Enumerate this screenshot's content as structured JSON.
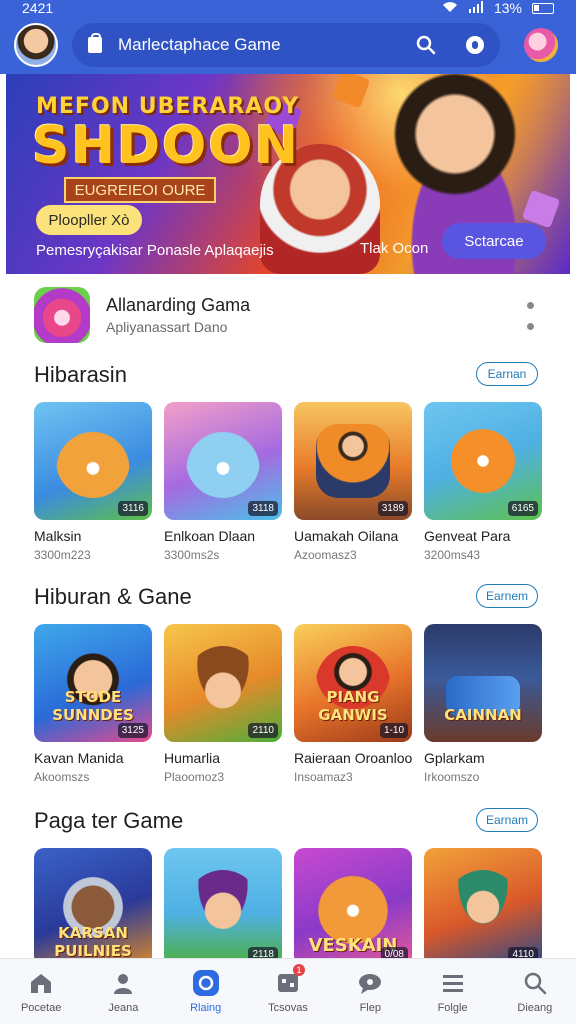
{
  "status_bar": {
    "time": "2421",
    "battery": "13%"
  },
  "search": {
    "placeholder": "Marlectaphace  Game"
  },
  "banner": {
    "title_line1": "MEFON UBERARAOY",
    "title_line2": "SHDOON",
    "ribbon": "EUGREIEOI OURE",
    "pill": "Ploopller Xò",
    "subtitle": "Pemesryçakisar Ponasle Aplaqaejis",
    "small_label": "Tlak Ocon",
    "cta": "Sctarcae"
  },
  "featured": {
    "name": "Allanarding Gama",
    "subtitle": "Apliyanassart Dano"
  },
  "sections": [
    {
      "title": "Hibarasin",
      "button": "Earnan",
      "items": [
        {
          "name": "Malksin",
          "sub": "3300m223",
          "badge": "3116"
        },
        {
          "name": "Enlkoan Dlaan",
          "sub": "3300ms2s",
          "badge": "3118"
        },
        {
          "name": "Uamakah Oilana",
          "sub": "Azoomasz3",
          "badge": "3189"
        },
        {
          "name": "Genveat Para",
          "sub": "3200ms43",
          "badge": "6165"
        }
      ]
    },
    {
      "title": "Hiburan & Gane",
      "button": "Earnem",
      "items": [
        {
          "name": "Kavan Manida",
          "sub": "Akoomszs",
          "badge": "3125",
          "art": "STODE SUNNDES"
        },
        {
          "name": "Humarlia",
          "sub": "Plaoomoz3",
          "badge": "2110",
          "art": ""
        },
        {
          "name": "Raieraan Oroanloo",
          "sub": "Insoamaz3",
          "badge": "1-10",
          "art": "PIANG GANWIS"
        },
        {
          "name": "Gplarkam",
          "sub": "Irkoomszo",
          "badge": "",
          "art": "CAINNAN"
        }
      ]
    },
    {
      "title": "Paga ter Game",
      "button": "Earnam",
      "items": [
        {
          "name": "",
          "sub": "",
          "badge": "",
          "art": "KARSAN PUILNIES"
        },
        {
          "name": "",
          "sub": "",
          "badge": "2118",
          "art": ""
        },
        {
          "name": "",
          "sub": "",
          "badge": "0/08",
          "art": "VESKAIN"
        },
        {
          "name": "",
          "sub": "",
          "badge": "4110",
          "art": ""
        }
      ]
    }
  ],
  "bottom_nav": [
    {
      "label": "Pocetae",
      "icon": "home-icon"
    },
    {
      "label": "Jeana",
      "icon": "person-icon"
    },
    {
      "label": "Rlaing",
      "icon": "chat-bubble-icon"
    },
    {
      "label": "Tcsovas",
      "icon": "gamepad-icon",
      "badge": "1"
    },
    {
      "label": "Flep",
      "icon": "speech-icon"
    },
    {
      "label": "Folgle",
      "icon": "list-icon"
    },
    {
      "label": "Dieang",
      "icon": "search-icon"
    }
  ],
  "colors": {
    "appbar": "#3b63d8",
    "accent": "#2f6be0",
    "pill_outline": "#1f7bb6"
  }
}
